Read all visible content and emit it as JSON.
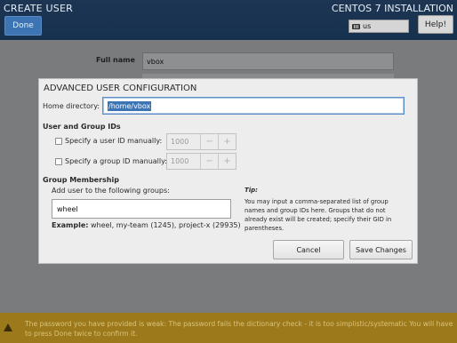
{
  "header": {
    "title": "CREATE USER",
    "install_title": "CENTOS 7 INSTALLATION",
    "done_label": "Done",
    "keyboard_layout": "us",
    "help_label": "Help!"
  },
  "background_form": {
    "fullname_label": "Full name",
    "fullname_value": "vbox"
  },
  "dialog": {
    "title": "ADVANCED USER CONFIGURATION",
    "home_label": "Home directory:",
    "home_value": "/home/vbox",
    "ids_heading": "User and Group IDs",
    "user_id_label": "Specify a user ID manually:",
    "user_id_value": "1000",
    "group_id_label": "Specify a group ID manually:",
    "group_id_value": "1000",
    "minus": "−",
    "plus": "+",
    "membership_heading": "Group Membership",
    "add_groups_label": "Add user to the following groups:",
    "groups_value": "wheel",
    "example_label": "Example:",
    "example_text": " wheel, my-team (1245), project-x (29935)",
    "tip_title": "Tip:",
    "tip_text": "You may input a comma-separated list of group names and group IDs here. Groups that do not already exist will be created; specify their GID in parentheses.",
    "cancel_label": "Cancel",
    "save_label": "Save Changes"
  },
  "warning": {
    "text": "The password you have provided is weak: The password fails the dictionary check - it is too simplistic/systematic You will have to press Done twice to confirm it."
  },
  "colors": {
    "header_bg": "#16314f",
    "accent": "#3d74b3",
    "warning_bg": "#9c7a1c"
  }
}
